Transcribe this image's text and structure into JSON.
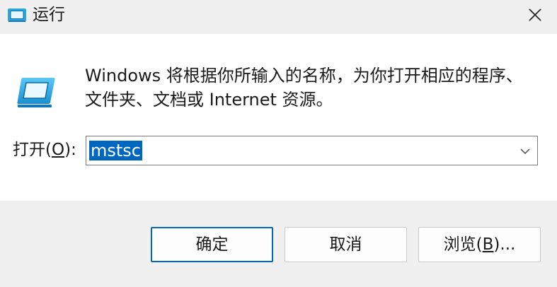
{
  "window": {
    "title": "运行",
    "icon": "run-icon",
    "close_icon": "close-icon"
  },
  "dialog": {
    "description": "Windows 将根据你所输入的名称，为你打开相应的程序、文件夹、文档或 Internet 资源。",
    "open_label_prefix": "打开(",
    "open_label_accel": "O",
    "open_label_suffix": "):",
    "input_value": "mstsc",
    "input_selected": true,
    "dropdown_icon": "chevron-down-icon"
  },
  "buttons": {
    "ok": "确定",
    "cancel": "取消",
    "browse_prefix": "浏览(",
    "browse_accel": "B",
    "browse_suffix": ")..."
  },
  "colors": {
    "accent": "#0067c0",
    "background": "#f0f0f0",
    "content_background": "#ffffff"
  }
}
